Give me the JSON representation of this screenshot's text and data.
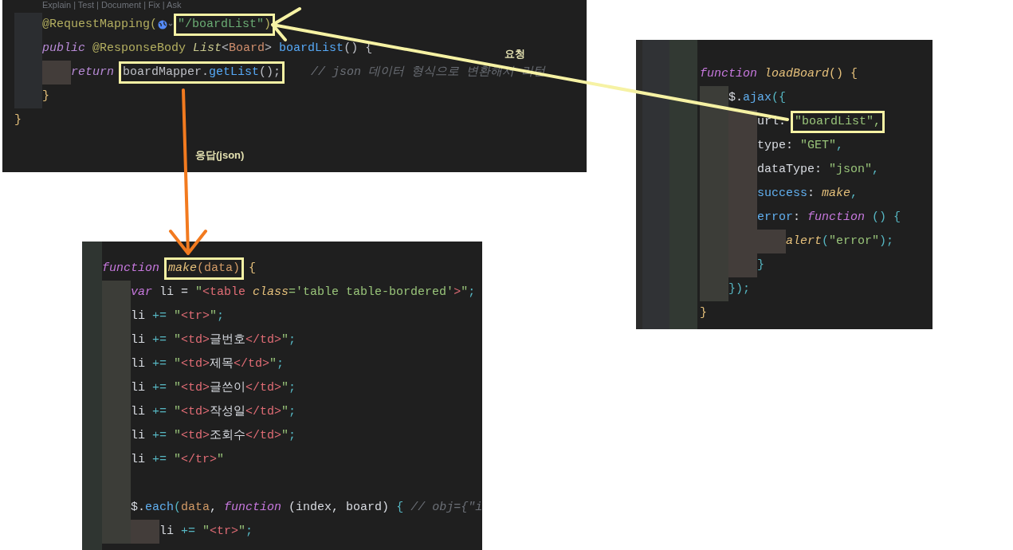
{
  "panels": [
    {
      "codelens": "Explain | Test | Document | Fix | Ask",
      "lines": [
        {
          "kind": "group",
          "children": [
            {
              "kind": "code",
              "tokens": [
                {
                  "text": "@RequestMapping(",
                  "kind": "annot"
                },
                {
                  "kind": "web-icon"
                },
                {
                  "text": "\"/boardList\"",
                  "kind": "str",
                  "highlighted": true
                },
                {
                  "text": ")",
                  "kind": "annot",
                  "highlighted": true
                }
              ]
            },
            {
              "kind": "code",
              "tokens": [
                {
                  "text": "public",
                  "kind": "kw"
                },
                {
                  "text": " @ResponseBody ",
                  "kind": "annot"
                },
                {
                  "text": "List",
                  "kind": "type"
                },
                {
                  "text": "<",
                  "kind": "plain"
                },
                {
                  "text": "Board",
                  "kind": "cls"
                },
                {
                  "text": "> ",
                  "kind": "plain"
                },
                {
                  "text": "boardList",
                  "kind": "fn"
                },
                {
                  "text": "() {",
                  "kind": "plain"
                }
              ],
              "children": [
                {
                  "kind": "code",
                  "tokens": [
                    {
                      "text": "return ",
                      "kind": "kw"
                    },
                    {
                      "text": "boardMapper.",
                      "kind": "plain",
                      "highlighted": true
                    },
                    {
                      "text": "getList",
                      "kind": "fn",
                      "highlighted": true
                    },
                    {
                      "text": "();",
                      "kind": "plain",
                      "highlighted": true
                    },
                    {
                      "text": "    // json 데이터 형식으로 변환해서 리턴",
                      "kind": "comment"
                    }
                  ]
                }
              ]
            },
            {
              "kind": "code",
              "tokens": [
                {
                  "text": "}",
                  "kind": "brace"
                }
              ]
            }
          ]
        },
        {
          "kind": "code",
          "tokens": [
            {
              "text": "}",
              "kind": "brace"
            }
          ]
        }
      ]
    },
    {
      "lines": [
        {
          "kind": "code",
          "tokens": [
            {
              "text": "function ",
              "kind": "kw"
            },
            {
              "text": "make",
              "kind": "fnit",
              "highlighted": true
            },
            {
              "text": "(data)",
              "kind": "param",
              "highlighted": true
            },
            {
              "text": " {",
              "kind": "brace"
            }
          ],
          "children": [
            {
              "kind": "code",
              "tokens": [
                {
                  "text": "var",
                  "kind": "kw"
                },
                {
                  "text": " li = ",
                  "kind": "plain"
                },
                {
                  "text": "\"",
                  "kind": "str"
                },
                {
                  "text": "<table",
                  "kind": "tag"
                },
                {
                  "text": " class",
                  "kind": "attr"
                },
                {
                  "text": "='table table-bordered'",
                  "kind": "str"
                },
                {
                  "text": ">",
                  "kind": "tag"
                },
                {
                  "text": "\"",
                  "kind": "str"
                },
                {
                  "text": ";",
                  "kind": "punct"
                }
              ]
            },
            {
              "kind": "code",
              "tokens": [
                {
                  "text": "li ",
                  "kind": "plain"
                },
                {
                  "text": "+=",
                  "kind": "punct"
                },
                {
                  "text": " \"",
                  "kind": "str"
                },
                {
                  "text": "<tr>",
                  "kind": "tag"
                },
                {
                  "text": "\"",
                  "kind": "str"
                },
                {
                  "text": ";",
                  "kind": "punct"
                }
              ]
            },
            {
              "kind": "code",
              "tokens": [
                {
                  "text": "li ",
                  "kind": "plain"
                },
                {
                  "text": "+=",
                  "kind": "punct"
                },
                {
                  "text": " \"",
                  "kind": "str"
                },
                {
                  "text": "<td>",
                  "kind": "tag"
                },
                {
                  "text": "글번호",
                  "kind": "plain"
                },
                {
                  "text": "</td>",
                  "kind": "tag"
                },
                {
                  "text": "\"",
                  "kind": "str"
                },
                {
                  "text": ";",
                  "kind": "punct"
                }
              ]
            },
            {
              "kind": "code",
              "tokens": [
                {
                  "text": "li ",
                  "kind": "plain"
                },
                {
                  "text": "+=",
                  "kind": "punct"
                },
                {
                  "text": " \"",
                  "kind": "str"
                },
                {
                  "text": "<td>",
                  "kind": "tag"
                },
                {
                  "text": "제목",
                  "kind": "plain"
                },
                {
                  "text": "</td>",
                  "kind": "tag"
                },
                {
                  "text": "\"",
                  "kind": "str"
                },
                {
                  "text": ";",
                  "kind": "punct"
                }
              ]
            },
            {
              "kind": "code",
              "tokens": [
                {
                  "text": "li ",
                  "kind": "plain"
                },
                {
                  "text": "+=",
                  "kind": "punct"
                },
                {
                  "text": " \"",
                  "kind": "str"
                },
                {
                  "text": "<td>",
                  "kind": "tag"
                },
                {
                  "text": "글쓴이",
                  "kind": "plain"
                },
                {
                  "text": "</td>",
                  "kind": "tag"
                },
                {
                  "text": "\"",
                  "kind": "str"
                },
                {
                  "text": ";",
                  "kind": "punct"
                }
              ]
            },
            {
              "kind": "code",
              "tokens": [
                {
                  "text": "li ",
                  "kind": "plain"
                },
                {
                  "text": "+=",
                  "kind": "punct"
                },
                {
                  "text": " \"",
                  "kind": "str"
                },
                {
                  "text": "<td>",
                  "kind": "tag"
                },
                {
                  "text": "작성일",
                  "kind": "plain"
                },
                {
                  "text": "</td>",
                  "kind": "tag"
                },
                {
                  "text": "\"",
                  "kind": "str"
                },
                {
                  "text": ";",
                  "kind": "punct"
                }
              ]
            },
            {
              "kind": "code",
              "tokens": [
                {
                  "text": "li ",
                  "kind": "plain"
                },
                {
                  "text": "+=",
                  "kind": "punct"
                },
                {
                  "text": " \"",
                  "kind": "str"
                },
                {
                  "text": "<td>",
                  "kind": "tag"
                },
                {
                  "text": "조회수",
                  "kind": "plain"
                },
                {
                  "text": "</td>",
                  "kind": "tag"
                },
                {
                  "text": "\"",
                  "kind": "str"
                },
                {
                  "text": ";",
                  "kind": "punct"
                }
              ]
            },
            {
              "kind": "code",
              "tokens": [
                {
                  "text": "li ",
                  "kind": "plain"
                },
                {
                  "text": "+=",
                  "kind": "punct"
                },
                {
                  "text": " \"",
                  "kind": "str"
                },
                {
                  "text": "</tr>",
                  "kind": "tag"
                },
                {
                  "text": "\"",
                  "kind": "str"
                }
              ]
            },
            {
              "kind": "blank"
            },
            {
              "kind": "code",
              "tokens": [
                {
                  "text": "$.",
                  "kind": "plain"
                },
                {
                  "text": "each",
                  "kind": "fn"
                },
                {
                  "text": "(",
                  "kind": "punct"
                },
                {
                  "text": "data",
                  "kind": "param"
                },
                {
                  "text": ", ",
                  "kind": "plain"
                },
                {
                  "text": "function",
                  "kind": "kw"
                },
                {
                  "text": " (index, board) ",
                  "kind": "plain"
                },
                {
                  "text": "{ ",
                  "kind": "punct"
                },
                {
                  "text": "// obj={\"i",
                  "kind": "comment"
                }
              ],
              "children": [
                {
                  "kind": "code",
                  "tokens": [
                    {
                      "text": "li ",
                      "kind": "plain"
                    },
                    {
                      "text": "+=",
                      "kind": "punct"
                    },
                    {
                      "text": " \"",
                      "kind": "str"
                    },
                    {
                      "text": "<tr>",
                      "kind": "tag"
                    },
                    {
                      "text": "\"",
                      "kind": "str"
                    },
                    {
                      "text": ";",
                      "kind": "punct"
                    }
                  ]
                }
              ]
            }
          ]
        }
      ]
    },
    {
      "lines": [
        {
          "kind": "code",
          "tokens": [
            {
              "text": "function ",
              "kind": "kw"
            },
            {
              "text": "loadBoard",
              "kind": "fnit"
            },
            {
              "text": "() {",
              "kind": "brace"
            }
          ],
          "children": [
            {
              "kind": "code",
              "tokens": [
                {
                  "text": "$.",
                  "kind": "plain"
                },
                {
                  "text": "ajax",
                  "kind": "fn"
                },
                {
                  "text": "({",
                  "kind": "punct"
                }
              ],
              "children": [
                {
                  "kind": "code",
                  "tokens": [
                    {
                      "text": "url: ",
                      "kind": "plain"
                    },
                    {
                      "text": "\"boardList\",",
                      "kind": "str",
                      "highlighted": true
                    }
                  ]
                },
                {
                  "kind": "code",
                  "tokens": [
                    {
                      "text": "type: ",
                      "kind": "plain"
                    },
                    {
                      "text": "\"GET\"",
                      "kind": "str"
                    },
                    {
                      "text": ",",
                      "kind": "punct"
                    }
                  ]
                },
                {
                  "kind": "code",
                  "tokens": [
                    {
                      "text": "dataType: ",
                      "kind": "plain"
                    },
                    {
                      "text": "\"json\"",
                      "kind": "str"
                    },
                    {
                      "text": ",",
                      "kind": "punct"
                    }
                  ]
                },
                {
                  "kind": "code",
                  "tokens": [
                    {
                      "text": "success",
                      "kind": "fn"
                    },
                    {
                      "text": ": ",
                      "kind": "plain"
                    },
                    {
                      "text": "make",
                      "kind": "fnit"
                    },
                    {
                      "text": ",",
                      "kind": "punct"
                    }
                  ]
                },
                {
                  "kind": "code",
                  "tokens": [
                    {
                      "text": "error",
                      "kind": "fn"
                    },
                    {
                      "text": ": ",
                      "kind": "plain"
                    },
                    {
                      "text": "function",
                      "kind": "kw"
                    },
                    {
                      "text": " () {",
                      "kind": "punct"
                    }
                  ],
                  "children": [
                    {
                      "kind": "code",
                      "tokens": [
                        {
                          "text": "alert",
                          "kind": "fnit"
                        },
                        {
                          "text": "(",
                          "kind": "punct"
                        },
                        {
                          "text": "\"error\"",
                          "kind": "str"
                        },
                        {
                          "text": ");",
                          "kind": "punct"
                        }
                      ]
                    }
                  ]
                },
                {
                  "kind": "code",
                  "tokens": [
                    {
                      "text": "}",
                      "kind": "punct"
                    }
                  ]
                }
              ]
            },
            {
              "kind": "code",
              "tokens": [
                {
                  "text": "});",
                  "kind": "punct"
                }
              ]
            }
          ]
        },
        {
          "kind": "code",
          "tokens": [
            {
              "text": "}",
              "kind": "brace"
            }
          ]
        }
      ]
    }
  ],
  "annotations": [
    {
      "kind": "arrow",
      "color": "#f6f2a4",
      "label": "요청"
    },
    {
      "kind": "arrow",
      "color": "#f27a1f",
      "label": "응답(json)"
    }
  ]
}
